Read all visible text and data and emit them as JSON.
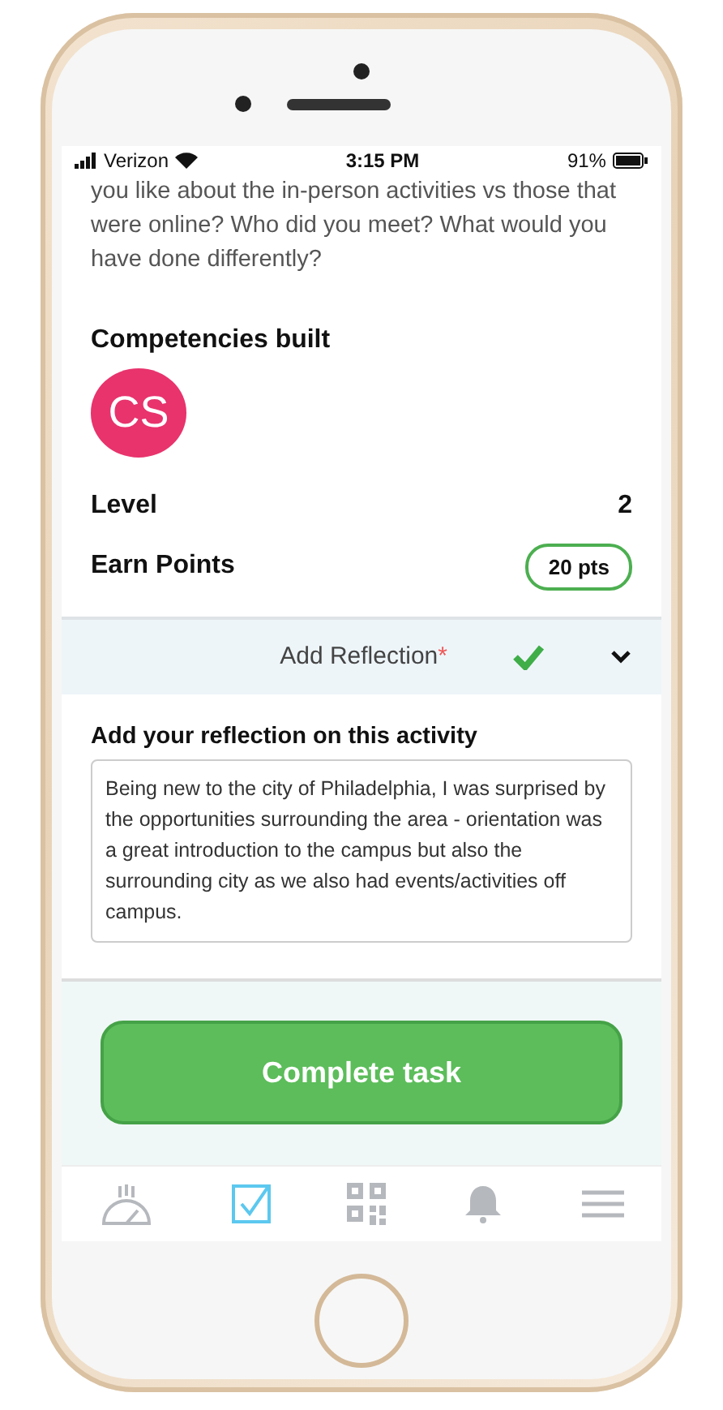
{
  "status_bar": {
    "carrier": "Verizon",
    "time": "3:15 PM",
    "battery": "91%"
  },
  "question": "you like about the in-person activities vs those that were online? Who did you meet? What would you have done differently?",
  "competencies": {
    "title": "Competencies built",
    "items": [
      {
        "initials": "CS"
      }
    ]
  },
  "level": {
    "label": "Level",
    "value": "2"
  },
  "points": {
    "label": "Earn Points",
    "value": "20 pts"
  },
  "reflection": {
    "title": "Add Reflection",
    "required_mark": "*",
    "completed": true,
    "expanded": true,
    "field_label": "Add your reflection on this activity",
    "value": "Being new to the city of Philadelphia, I was surprised by the opportunities surrounding the area - orientation was a great introduction to the campus but also the surrounding city as we also had events/activities off campus."
  },
  "complete_button": "Complete task",
  "tab_bar": [
    {
      "selected": false
    },
    {
      "selected": true
    },
    {
      "selected": false
    },
    {
      "selected": false
    },
    {
      "selected": false
    }
  ]
}
